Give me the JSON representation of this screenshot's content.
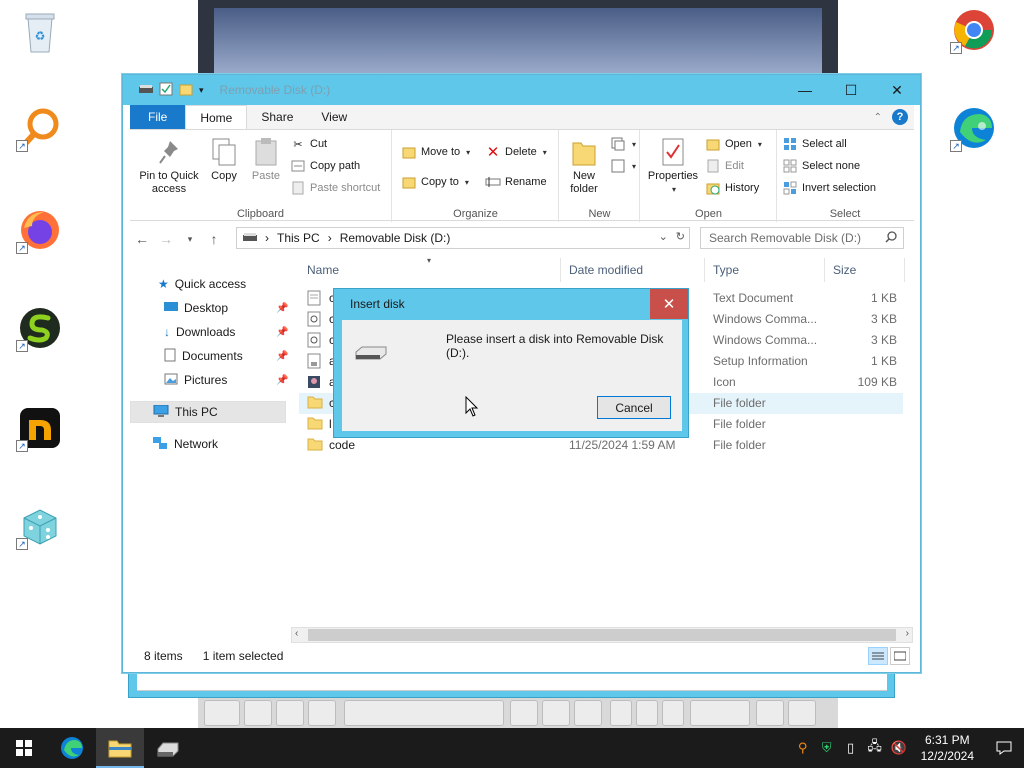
{
  "window": {
    "title": "Removable Disk (D:)",
    "controls": [
      "minimize",
      "maximize",
      "close"
    ]
  },
  "ribbon_tabs": [
    {
      "label": "File"
    },
    {
      "label": "Home"
    },
    {
      "label": "Share"
    },
    {
      "label": "View"
    }
  ],
  "ribbon": {
    "clipboard": {
      "group_label": "Clipboard",
      "pin_label": "Pin to Quick access",
      "copy_label": "Copy",
      "paste_label": "Paste",
      "cut_label": "Cut",
      "copy_path_label": "Copy path",
      "paste_shortcut_label": "Paste shortcut"
    },
    "organize": {
      "group_label": "Organize",
      "move_to_label": "Move to",
      "copy_to_label": "Copy to",
      "delete_label": "Delete",
      "rename_label": "Rename"
    },
    "new": {
      "group_label": "New",
      "new_folder_label": "New folder"
    },
    "open": {
      "group_label": "Open",
      "properties_label": "Properties",
      "open_label": "Open",
      "edit_label": "Edit",
      "history_label": "History"
    },
    "select": {
      "group_label": "Select",
      "select_all_label": "Select all",
      "select_none_label": "Select none",
      "invert_label": "Invert selection"
    }
  },
  "address": {
    "crumbs": [
      "This PC",
      "Removable Disk (D:)"
    ],
    "search_placeholder": "Search Removable Disk (D:)"
  },
  "nav": {
    "quick_access": "Quick access",
    "desktop": "Desktop",
    "downloads": "Downloads",
    "documents": "Documents",
    "pictures": "Pictures",
    "this_pc": "This PC",
    "network": "Network"
  },
  "columns": {
    "name": "Name",
    "date": "Date modified",
    "type": "Type",
    "size": "Size"
  },
  "files": [
    {
      "name": "c",
      "date": "",
      "type": "Text Document",
      "size": "1 KB"
    },
    {
      "name": "c",
      "date": "",
      "type": "Windows Comma...",
      "size": "3 KB"
    },
    {
      "name": "c",
      "date": "",
      "type": "Windows Comma...",
      "size": "3 KB"
    },
    {
      "name": "a",
      "date": "",
      "type": "Setup Information",
      "size": "1 KB"
    },
    {
      "name": "a",
      "date": "",
      "type": "Icon",
      "size": "109 KB"
    },
    {
      "name": "c",
      "date": "",
      "type": "File folder",
      "size": ""
    },
    {
      "name": "l",
      "date": "",
      "type": "File folder",
      "size": ""
    },
    {
      "name": "code",
      "date": "11/25/2024 1:59 AM",
      "type": "File folder",
      "size": ""
    }
  ],
  "status": {
    "item_count": "8 items",
    "selection": "1 item selected"
  },
  "dialog": {
    "title": "Insert disk",
    "message": "Please insert a disk into Removable Disk (D:).",
    "cancel_label": "Cancel"
  },
  "taskbar": {
    "time": "6:31 PM",
    "date": "12/2/2024"
  },
  "colors": {
    "titlebar": "#5ec7ea",
    "file_tab": "#1979ca",
    "close_red": "#c9504a",
    "taskbar": "#1b1b1b"
  }
}
